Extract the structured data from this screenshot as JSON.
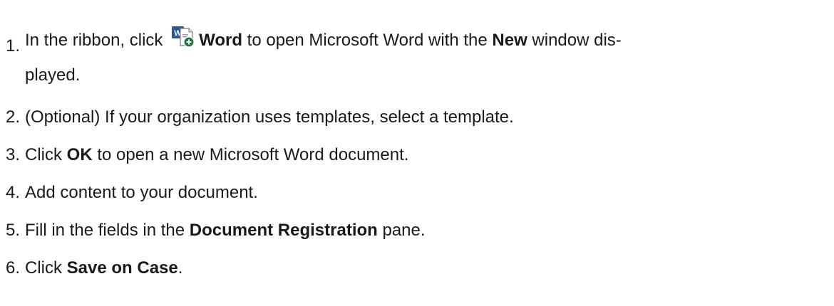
{
  "steps": [
    {
      "num": "1.",
      "a": "In the ribbon, click ",
      "b": "Word",
      "c": " to open Microsoft Word with the ",
      "d": "New",
      "e": " window dis-",
      "cont": "played.",
      "icon": "word-new-icon"
    },
    {
      "num": "2.",
      "text": "(Optional) If your organization uses templates, select a template."
    },
    {
      "num": "3.",
      "a": "Click ",
      "b": "OK",
      "c": " to open a new Microsoft Word document."
    },
    {
      "num": "4.",
      "text": "Add content to your document."
    },
    {
      "num": "5.",
      "a": "Fill in the fields in the ",
      "b": "Document Registration",
      "c": " pane."
    },
    {
      "num": "6.",
      "a": "Click ",
      "b": "Save on Case",
      "c": "."
    }
  ],
  "colors": {
    "text": "#1a1a1a",
    "icon_blue": "#2b579a",
    "icon_green": "#217346"
  }
}
